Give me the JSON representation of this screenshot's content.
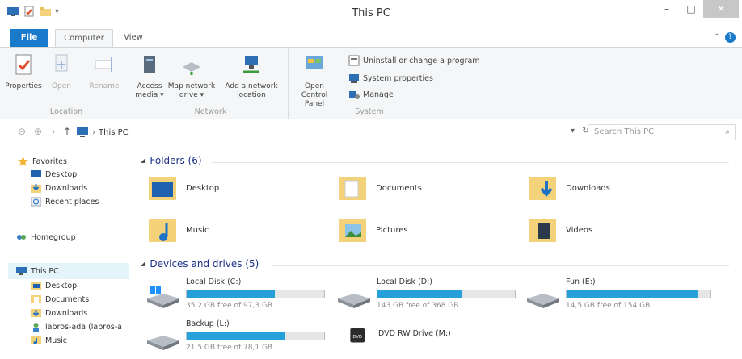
{
  "window": {
    "title": "This PC"
  },
  "ribbon_tabs": [
    "File",
    "Computer",
    "View"
  ],
  "ribbon": {
    "location": {
      "label": "Location",
      "properties": "Properties",
      "open": "Open",
      "rename": "Rename"
    },
    "network": {
      "label": "Network",
      "access_media": [
        "Access",
        "media ▾"
      ],
      "map_drive": [
        "Map network",
        "drive ▾"
      ],
      "add_location": [
        "Add a network",
        "location"
      ]
    },
    "system": {
      "label": "System",
      "open_cp": [
        "Open Control",
        "Panel"
      ],
      "uninstall": "Uninstall or change a program",
      "sys_props": "System properties",
      "manage": "Manage"
    }
  },
  "address": {
    "path": "This PC",
    "search_placeholder": "Search This PC"
  },
  "nav": {
    "favorites": "Favorites",
    "favorites_items": [
      "Desktop",
      "Downloads",
      "Recent places"
    ],
    "homegroup": "Homegroup",
    "this_pc": "This PC",
    "this_pc_items": [
      "Desktop",
      "Documents",
      "Downloads",
      "labros-ada (labros-a",
      "Music"
    ]
  },
  "folders": {
    "header": "Folders (6)",
    "items": [
      "Desktop",
      "Documents",
      "Downloads",
      "Music",
      "Pictures",
      "Videos"
    ]
  },
  "devices": {
    "header": "Devices and drives (5)",
    "drives": [
      {
        "name": "Local Disk (C:)",
        "free": "35,2 GB free of 97,3 GB",
        "used_fraction": 0.64
      },
      {
        "name": "Local Disk (D:)",
        "free": "143 GB free of 368 GB",
        "used_fraction": 0.61
      },
      {
        "name": "Fun (E:)",
        "free": "14,5 GB free of 154 GB",
        "used_fraction": 0.91
      },
      {
        "name": "Backup (L:)",
        "free": "21,5 GB free of 78,1 GB",
        "used_fraction": 0.72
      }
    ],
    "dvd": {
      "name": "DVD RW Drive (M:)"
    }
  },
  "colors": {
    "accent": "#1979ca",
    "drive_fill": "#26a0da",
    "section_header": "#1e3287"
  }
}
